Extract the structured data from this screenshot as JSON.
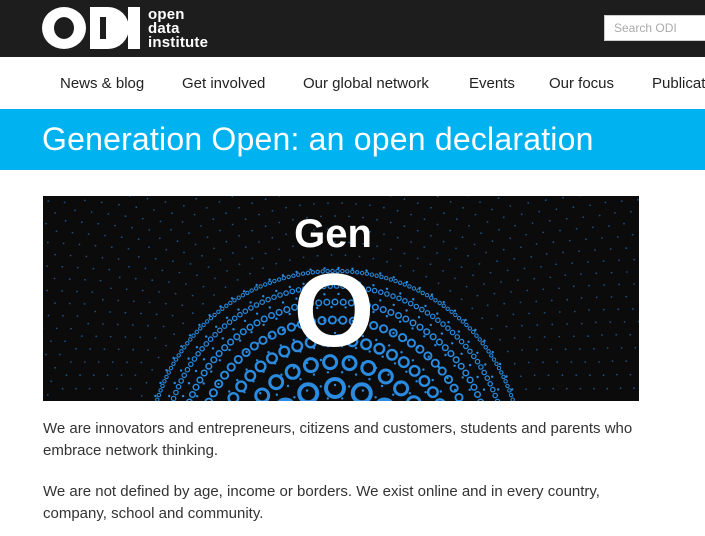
{
  "brand": {
    "logo_letters": "ODI",
    "logo_lines": [
      "open",
      "data",
      "institute"
    ]
  },
  "search": {
    "placeholder": "Search ODI"
  },
  "nav": {
    "items": [
      {
        "label": "News & blog"
      },
      {
        "label": "Get involved"
      },
      {
        "label": "Our global network"
      },
      {
        "label": "Events"
      },
      {
        "label": "Our focus"
      },
      {
        "label": "Publications"
      }
    ]
  },
  "banner": {
    "title": "Generation Open: an open declaration"
  },
  "hero": {
    "word_top": "Gen",
    "word_big": "O"
  },
  "content": {
    "paragraphs": [
      "We are innovators and entrepreneurs, citizens and customers, students and parents who embrace network thinking.",
      "We are not defined by age, income or borders. We exist online and in every country, company, school and community."
    ]
  },
  "colors": {
    "topbar": "#1d1d1d",
    "banner": "#00b2f0",
    "hero_bg": "#0b0b0b",
    "hero_ring": "#2a8be0"
  }
}
